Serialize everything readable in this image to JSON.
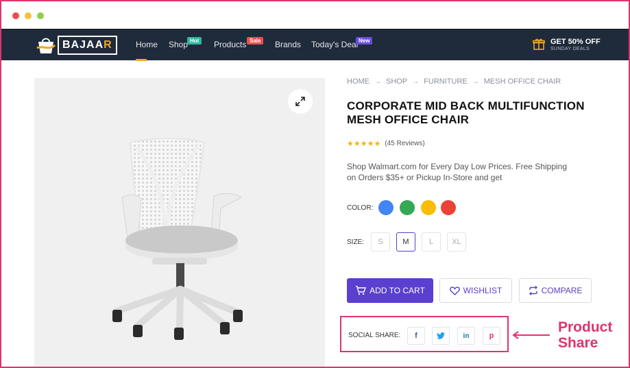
{
  "window": {
    "dot_colors": [
      "#e94f4f",
      "#f5c03b",
      "#8ed04a"
    ]
  },
  "brand": {
    "name_main": "BAJAA",
    "name_last": "R"
  },
  "nav": {
    "items": [
      {
        "label": "Home",
        "badge": ""
      },
      {
        "label": "Shop",
        "badge": "Hot",
        "badge_color": "#2bb8a0"
      },
      {
        "label": "Products",
        "badge": "Sale",
        "badge_color": "#e94f4f"
      },
      {
        "label": "Brands",
        "badge": ""
      },
      {
        "label": "Today's Deal",
        "badge": "New",
        "badge_color": "#6b4de0"
      }
    ],
    "active": "Home"
  },
  "promo": {
    "title": "GET 50% OFF",
    "subtitle": "SUNDAY DEALS",
    "icon": "gift-icon"
  },
  "breadcrumb": [
    "HOME",
    "SHOP",
    "FURNITURE",
    "MESH OFFICE CHAIR"
  ],
  "product": {
    "title": "CORPORATE MID BACK MULTIFUNCTION MESH OFFICE CHAIR",
    "rating_stars": 5,
    "reviews": "(45 Reviews)",
    "description": "Shop Walmart.com for Every Day Low Prices. Free Shipping on Orders $35+ or Pickup In-Store and get"
  },
  "options": {
    "color_label": "COLOR:",
    "colors": [
      "#4285f4",
      "#34a853",
      "#fbbc05",
      "#ea4335"
    ],
    "size_label": "SIZE:",
    "sizes": [
      "S",
      "M",
      "L",
      "XL"
    ],
    "selected_size": "M"
  },
  "actions": {
    "add_to_cart": "ADD TO CART",
    "wishlist": "WISHLIST",
    "compare": "COMPARE"
  },
  "share": {
    "label": "SOCIAL SHARE:",
    "networks": [
      {
        "name": "facebook",
        "glyph": "f",
        "color": "#3b5998"
      },
      {
        "name": "twitter",
        "glyph": "t",
        "color": "#1da1f2"
      },
      {
        "name": "linkedin",
        "glyph": "in",
        "color": "#0e76a8"
      },
      {
        "name": "pinterest",
        "glyph": "p",
        "color": "#e0336e"
      }
    ]
  },
  "annotation": {
    "line1": "Product",
    "line2": "Share",
    "color": "#e0336e"
  },
  "accent": "#5a3fd0",
  "highlight": "#e0336e"
}
